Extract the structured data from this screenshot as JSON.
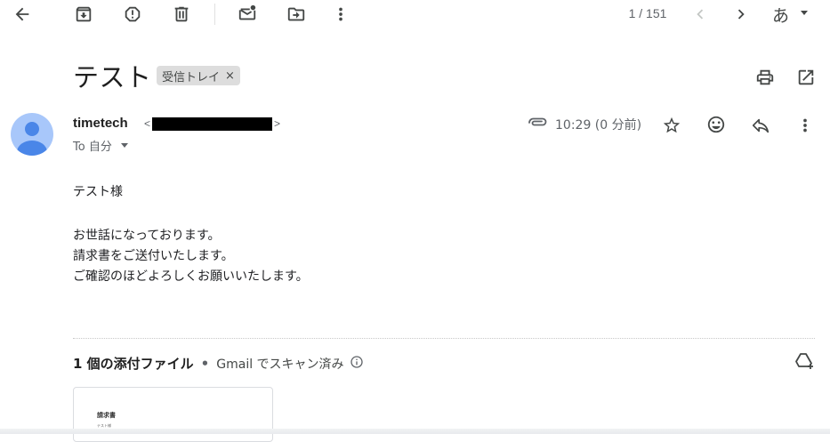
{
  "toolbar": {
    "icons": [
      "back-arrow-icon",
      "archive-icon",
      "report-spam-icon",
      "delete-icon",
      "mark-unread-icon",
      "move-to-icon",
      "more-vert-icon"
    ],
    "counter": "1 / 151",
    "ime_label": "あ"
  },
  "subject": {
    "title": "テスト",
    "label": "受信トレイ",
    "label_remove": "×"
  },
  "message": {
    "sender_name": "timetech",
    "email_open": "<",
    "email_close": ">",
    "to_label": "To 自分",
    "time": "10:29 (0 分前)",
    "body": {
      "greeting": "テスト様",
      "line1": "お世話になっております。",
      "line2": "請求書をご送付いたします。",
      "line3": "ご確認のほどよろしくお願いいたします。"
    }
  },
  "attachments": {
    "count_label": "1 個の添付ファイル",
    "separator": "•",
    "scan_label": "Gmail でスキャン済み",
    "items": [
      {
        "thumb_title": "請求書",
        "thumb_sub": "テスト様"
      }
    ]
  },
  "colors": {
    "avatar_bg": "#a8c7fa",
    "avatar_fg": "#4a86e8",
    "chip_bg": "#dddddd",
    "icon": "#444746"
  }
}
